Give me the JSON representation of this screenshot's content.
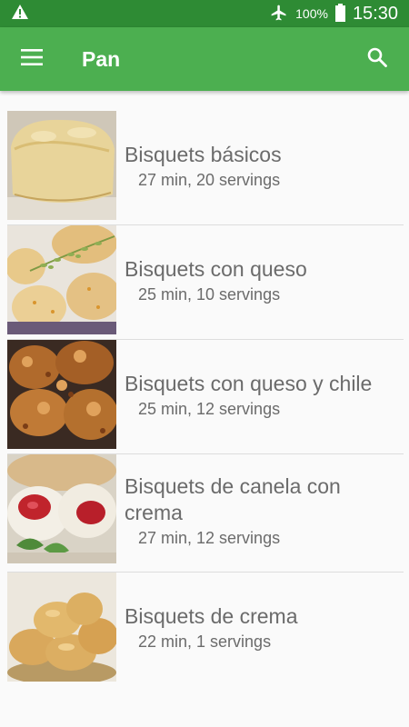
{
  "status_bar": {
    "battery_text": "100%",
    "time": "15:30",
    "icons": [
      "warning-icon",
      "airplane-icon",
      "battery-icon"
    ]
  },
  "app_bar": {
    "title": "Pan",
    "icons": [
      "hamburger-menu-icon",
      "search-icon"
    ]
  },
  "recipes": [
    {
      "name": "Bisquets básicos",
      "meta": "27 min, 20 servings",
      "image": "plain-biscuit"
    },
    {
      "name": "Bisquets con queso",
      "meta": "25 min, 10 servings",
      "image": "cheese-biscuits-with-herb"
    },
    {
      "name": "Bisquets con queso y chile",
      "meta": "25 min, 12 servings",
      "image": "crispy-cheese-chile-biscuits"
    },
    {
      "name": "Bisquets de canela con crema",
      "meta": "27 min, 12 servings",
      "image": "biscuits-with-jam-and-cream"
    },
    {
      "name": "Bisquets de crema",
      "meta": "22 min, 1 servings",
      "image": "cream-biscuits-pile"
    }
  ],
  "colors": {
    "status_bar": "#2e8b34",
    "app_bar": "#4caf50",
    "text": "#6b6b6b",
    "background": "#fafafa"
  }
}
